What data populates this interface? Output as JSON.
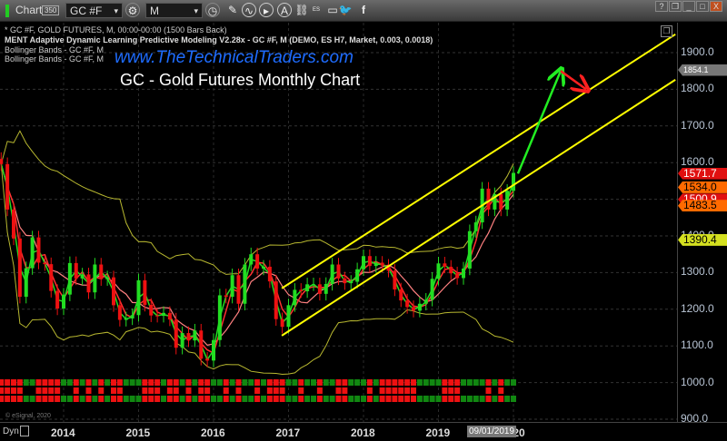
{
  "toolbar": {
    "app_label": "Chart",
    "symbol": "GC #F",
    "interval": "M",
    "badge": "350",
    "icons": [
      "pencil-icon",
      "chart-icon",
      "play-icon",
      "alert-icon",
      "link-icon",
      "es-icon",
      "comment-icon",
      "twitter-icon",
      "facebook-icon"
    ],
    "window_buttons": [
      "?",
      "❐",
      "_",
      "□",
      "X"
    ]
  },
  "legend": [
    "* GC #F, GOLD FUTURES, M, 00:00-00:00 (1500 Bars Back)",
    "MENT Adaptive Dynamic Learning Predictive Modeling V2.28x - GC #F, M (DEMO, ES H7, Market, 0.003, 0.0018)",
    "Bollinger Bands - GC #F, M",
    "Bollinger Bands - GC #F, M"
  ],
  "watermark": "www.TheTechnicalTraders.com",
  "copyright": "© eSignal, 2020",
  "status": {
    "mode": "Dyn",
    "cursor_date": "09/01/2019"
  },
  "chart_data": {
    "type": "candlestick",
    "title": "GC - Gold Futures Monthly Chart",
    "x_start": "2013-03",
    "x_interval": "monthly",
    "first_open": 1610,
    "close": [
      1596,
      1472,
      1393,
      1234,
      1312,
      1396,
      1327,
      1323,
      1250,
      1202,
      1240,
      1326,
      1284,
      1295,
      1246,
      1322,
      1282,
      1287,
      1211,
      1171,
      1175,
      1184,
      1279,
      1212,
      1183,
      1182,
      1190,
      1172,
      1095,
      1135,
      1115,
      1142,
      1065,
      1060,
      1116,
      1238,
      1234,
      1293,
      1215,
      1322,
      1350,
      1311,
      1316,
      1276,
      1173,
      1152,
      1211,
      1253,
      1249,
      1268,
      1268,
      1242,
      1269,
      1322,
      1284,
      1271,
      1275,
      1309,
      1345,
      1318,
      1327,
      1319,
      1305,
      1254,
      1224,
      1206,
      1196,
      1215,
      1226,
      1283,
      1325,
      1316,
      1298,
      1285,
      1311,
      1413,
      1437,
      1529,
      1472,
      1514,
      1472,
      1523,
      1572
    ],
    "ylim": [
      900,
      1950
    ],
    "y_ticks": [
      "1900.0",
      "1800.0",
      "1700.0",
      "1600.0",
      "1500.0",
      "1400.0",
      "1300.0",
      "1200.0",
      "1100.0",
      "1000.0",
      "900.0"
    ],
    "y_tick_values": [
      1900,
      1800,
      1700,
      1600,
      1500,
      1400,
      1300,
      1200,
      1100,
      1000,
      900
    ],
    "x_ticks": [
      "2014",
      "2015",
      "2016",
      "2017",
      "2018",
      "2019",
      "2020"
    ],
    "price_labels": [
      {
        "value": "1854.1",
        "color": "#777777",
        "text_color": "#ffffff"
      },
      {
        "value": "1571.7",
        "color": "#e01010",
        "text_color": "#ffffff"
      },
      {
        "value": "1534.0",
        "color": "#ff6a00",
        "text_color": "#000000"
      },
      {
        "value": "1500.9",
        "color": "#e01010",
        "text_color": "#ffffff"
      },
      {
        "value": "1483.5",
        "color": "#ff6a00",
        "text_color": "#000000"
      },
      {
        "value": "1390.4",
        "color": "#d4e020",
        "text_color": "#000000"
      }
    ],
    "channel_lines": [
      {
        "from": {
          "date": 2016.91,
          "price": 1257
        },
        "to": {
          "date": 2022.16,
          "price": 1950
        },
        "color": "#ffff00"
      },
      {
        "from": {
          "date": 2016.91,
          "price": 1128
        },
        "to": {
          "date": 2022.16,
          "price": 1826
        },
        "color": "#ffff00"
      }
    ],
    "projection_arrows": [
      {
        "from": {
          "date": 2020.06,
          "price": 1570
        },
        "to": {
          "date": 2020.63,
          "price": 1850
        },
        "color": "#22ee22"
      },
      {
        "from": {
          "date": 2020.63,
          "price": 1850
        },
        "to": {
          "date": 2020.97,
          "price": 1800
        },
        "color": "#ff2020"
      }
    ],
    "colors": {
      "up": "#22dd22",
      "down": "#ee1111",
      "band": "#b8b830",
      "ma_fast": "#ff3030",
      "ma_slow": "#ff8080"
    }
  }
}
